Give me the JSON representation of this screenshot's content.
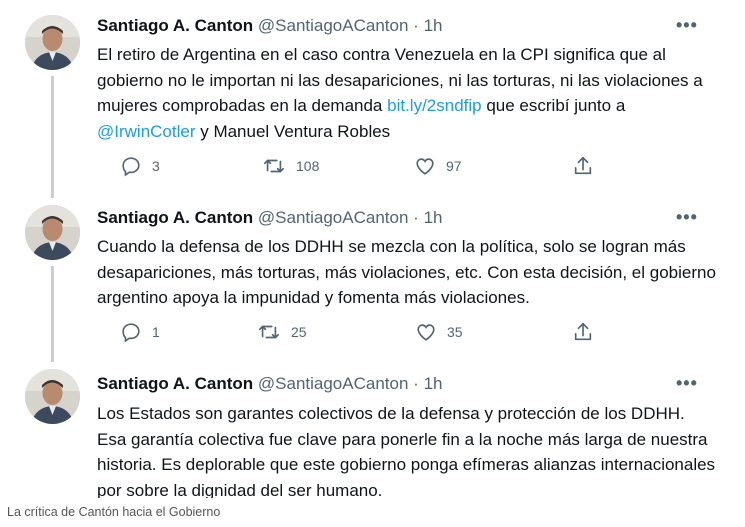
{
  "tweets": [
    {
      "name": "Santiago A. Canton",
      "handle": "@SantiagoACanton",
      "separator": "·",
      "time": "1h",
      "more": "•••",
      "text_parts": [
        "El retiro de Argentina en el caso contra Venezuela en la CPI significa que al gobierno no le importan ni las desapariciones, ni las torturas, ni las violaciones a mujeres comprobadas en la demanda ",
        "bit.ly/2sndfip",
        " que escribí junto a ",
        "@IrwinCotler",
        " y Manuel Ventura Robles"
      ],
      "replies": "3",
      "retweets": "108",
      "likes": "97"
    },
    {
      "name": "Santiago A. Canton",
      "handle": "@SantiagoACanton",
      "separator": "·",
      "time": "1h",
      "more": "•••",
      "text": "Cuando la defensa de los DDHH se mezcla con la política, solo se logran más desapariciones, más torturas, más violaciones, etc. Con esta decisión, el gobierno argentino apoya la impunidad y fomenta más violaciones.",
      "replies": "1",
      "retweets": "25",
      "likes": "35"
    },
    {
      "name": "Santiago A. Canton",
      "handle": "@SantiagoACanton",
      "separator": "·",
      "time": "1h",
      "more": "•••",
      "text": "Los Estados son garantes colectivos de la defensa y protección de los DDHH. Esa garantía colectiva fue clave para ponerle fin a la noche más larga de nuestra historia. Es deplorable que este gobierno ponga efímeras alianzas internacionales por sobre la dignidad del ser humano."
    }
  ],
  "icons": {
    "reply": "reply-icon",
    "retweet": "retweet-icon",
    "like": "heart-icon",
    "share": "share-icon"
  },
  "colors": {
    "link": "#1d9bf0",
    "muted": "#536471",
    "text": "#0f1419"
  },
  "caption": "La crítica de Cantón hacia el Gobierno"
}
